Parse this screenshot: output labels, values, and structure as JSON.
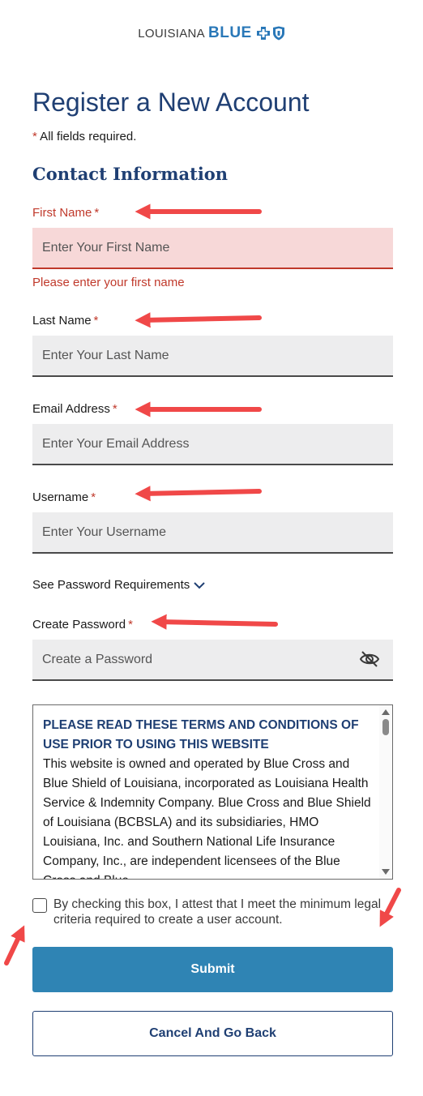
{
  "header": {
    "logo_word1": "LOUISIANA",
    "logo_word2": "BLUE"
  },
  "page": {
    "title": "Register a New Account",
    "required_star": "*",
    "required_note": " All fields required."
  },
  "section": {
    "title": "Contact Information"
  },
  "fields": {
    "first_name": {
      "label": "First Name",
      "star": "*",
      "placeholder": "Enter Your First Name",
      "error": "Please enter your first name"
    },
    "last_name": {
      "label": "Last Name",
      "star": "*",
      "placeholder": "Enter Your Last Name"
    },
    "email": {
      "label": "Email Address",
      "star": "*",
      "placeholder": "Enter Your Email Address"
    },
    "username": {
      "label": "Username",
      "star": "*",
      "placeholder": "Enter Your Username"
    },
    "password": {
      "requirements_link": "See Password Requirements",
      "label": "Create Password",
      "star": "*",
      "placeholder": "Create a Password"
    }
  },
  "terms": {
    "heading": "PLEASE READ THESE TERMS AND CONDITIONS OF USE PRIOR TO USING THIS WEBSITE",
    "body": "This website is owned and operated by Blue Cross and Blue Shield of Louisiana, incorporated as Louisiana Health Service & Indemnity Company. Blue Cross and Blue Shield of Louisiana (BCBSLA) and its subsidiaries, HMO Louisiana, Inc. and Southern National Life Insurance Company, Inc., are independent licensees of the Blue Cross and Blue"
  },
  "attest": {
    "text": "By checking this box, I attest that I meet the minimum legal criteria required to create a user account."
  },
  "buttons": {
    "submit": "Submit",
    "cancel": "Cancel And Go Back"
  },
  "colors": {
    "brand_navy": "#1f3f73",
    "brand_blue": "#2f84b4",
    "error_red": "#c0392b",
    "annotation_arrow": "#f04848"
  },
  "icons": {
    "logo": "blue-cross-blue-shield-icon",
    "chevron": "chevron-down-icon",
    "eye": "eye-slash-icon",
    "annotation": "arrow-annotation"
  }
}
